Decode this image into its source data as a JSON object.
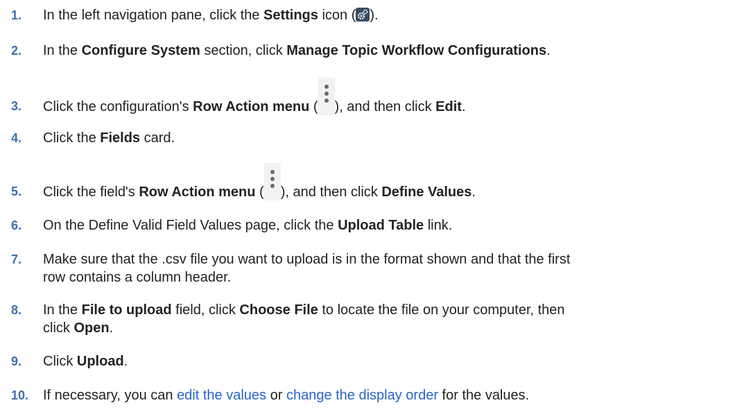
{
  "steps": [
    {
      "num": "1.",
      "a": "In the left navigation pane, click the ",
      "b": "Settings",
      "c": " icon (",
      "d": ")."
    },
    {
      "num": "2.",
      "a": "In the ",
      "b": "Configure System",
      "c": " section, click ",
      "d": "Manage Topic Workflow Configurations",
      "e": "."
    },
    {
      "num": "3.",
      "a": "Click the configuration's ",
      "b": "Row Action menu",
      "c": " (",
      "d": "), and then click ",
      "e": "Edit",
      "f": "."
    },
    {
      "num": "4.",
      "a": "Click the ",
      "b": "Fields",
      "c": " card."
    },
    {
      "num": "5.",
      "a": "Click the field's ",
      "b": "Row Action menu",
      "c": " (",
      "d": "), and then click ",
      "e": "Define Values",
      "f": "."
    },
    {
      "num": "6.",
      "a": "On the Define Valid Field Values page, click the ",
      "b": "Upload Table",
      "c": " link."
    },
    {
      "num": "7.",
      "a": "Make sure that the .csv file you want to upload is in the format shown and that the first",
      "b": "row contains a column header."
    },
    {
      "num": "8.",
      "a": "In the ",
      "b": "File to upload",
      "c": " field, click ",
      "d": "Choose File",
      "e": " to locate the file on your computer, then",
      "f": "click ",
      "g": "Open",
      "h": "."
    },
    {
      "num": "9.",
      "a": "Click ",
      "b": "Upload",
      "c": "."
    },
    {
      "num": "10.",
      "a": "If necessary, you can ",
      "link1": "edit the values",
      "b": " or ",
      "link2": "change the display order",
      "c": " for the values."
    }
  ],
  "icons": {
    "settings": "settings-gear-icon",
    "row_action": "row-action-menu-icon"
  },
  "colors": {
    "step_number": "#3e6fae",
    "link": "#2a62c9",
    "settings_icon_bg": "#3a4e63"
  }
}
